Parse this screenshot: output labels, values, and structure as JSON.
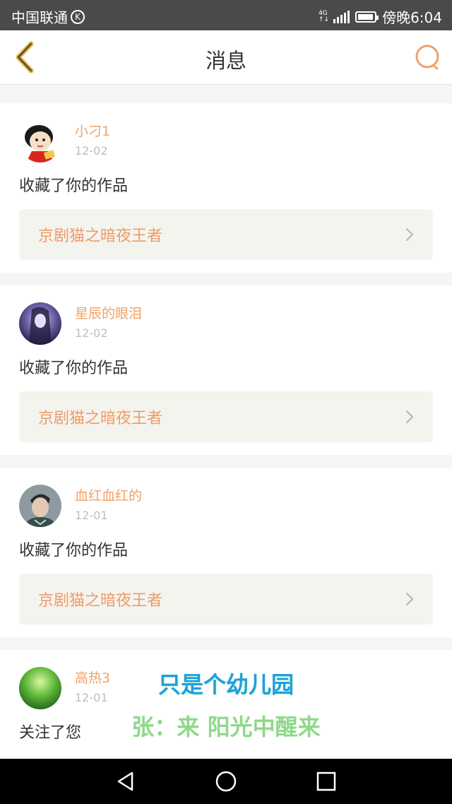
{
  "status_bar": {
    "carrier": "中国联通",
    "carrier_badge": "K",
    "network": "4G",
    "time": "傍晚6:04",
    "battery_level": 0.8
  },
  "header": {
    "title": "消息",
    "back_icon": "chevron-left-icon",
    "search_icon": "search-icon",
    "accent_color": "#f0a16a"
  },
  "messages": [
    {
      "username": "小刁1",
      "date": "12-02",
      "action": "收藏了你的作品",
      "work": "京剧猫之暗夜王者"
    },
    {
      "username": "星辰的眼泪",
      "date": "12-02",
      "action": "收藏了你的作品",
      "work": "京剧猫之暗夜王者"
    },
    {
      "username": "血红血红的",
      "date": "12-01",
      "action": "收藏了你的作品",
      "work": "京剧猫之暗夜王者"
    },
    {
      "username": "高热3",
      "date": "12-01",
      "action": "关注了您"
    }
  ],
  "overlay": {
    "line1": "只是个幼儿园",
    "line2": "张：来 阳光中醒来"
  },
  "nav": {
    "back": "triangle-back-icon",
    "home": "circle-home-icon",
    "recent": "square-recent-icon"
  }
}
